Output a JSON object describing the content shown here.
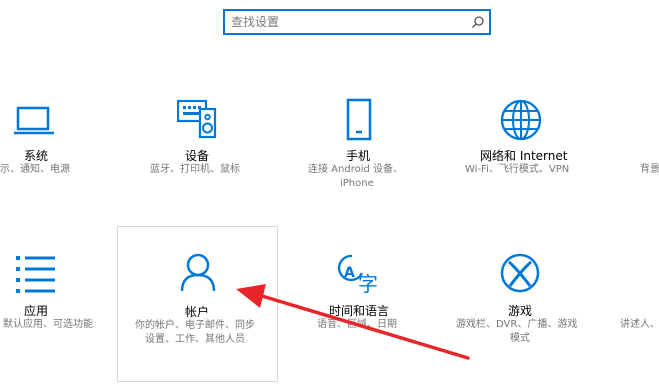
{
  "search": {
    "placeholder": "查找设置",
    "value": ""
  },
  "tiles": [
    {
      "title": "系统",
      "desc": [
        "示、通知、电源"
      ],
      "icon": "laptop-icon"
    },
    {
      "title": "设备",
      "desc": [
        "蓝牙、打印机、鼠标"
      ],
      "icon": "devices-icon"
    },
    {
      "title": "手机",
      "desc": [
        "连接 Android 设备、",
        "iPhone"
      ],
      "icon": "phone-icon"
    },
    {
      "title": "网络和 Internet",
      "desc": [
        "Wi-Fi、飞行模式、VPN"
      ],
      "icon": "globe-icon"
    },
    {
      "title": "",
      "desc": [
        "背景"
      ],
      "icon": ""
    },
    {
      "title": "应用",
      "desc": [
        "默认应用、可选功能"
      ],
      "icon": "apps-list-icon"
    },
    {
      "title": "帐户",
      "desc": [
        "你的帐户、电子邮件、同步",
        "设置、工作、其他人员"
      ],
      "icon": "person-icon"
    },
    {
      "title": "时间和语言",
      "desc": [
        "语音、区域、日期"
      ],
      "icon": "time-language-icon"
    },
    {
      "title": "游戏",
      "desc": [
        "游戏栏、DVR、广播、游戏",
        "模式"
      ],
      "icon": "xbox-icon"
    },
    {
      "title": "",
      "desc": [
        "讲述人、"
      ],
      "icon": ""
    }
  ],
  "colors": {
    "accent": "#0078d7",
    "arrow": "#e8262a",
    "desc": "#767676"
  }
}
